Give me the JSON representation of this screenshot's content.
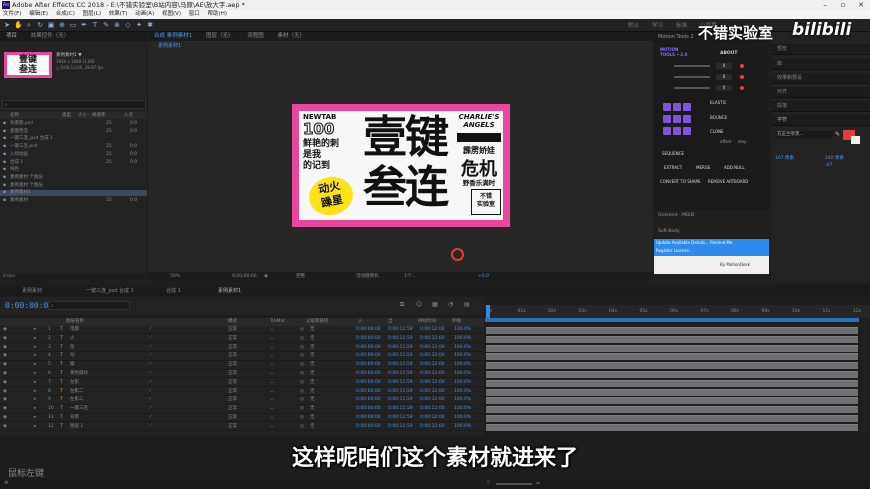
{
  "window": {
    "title": "Adobe After Effects CC 2018 - E:\\不错实验室\\B站内容\\马原\\AE\\放大字.aep *",
    "app_icon": "Ae"
  },
  "menu": [
    "文件(F)",
    "编辑(E)",
    "合成(C)",
    "图层(L)",
    "效果(T)",
    "动画(A)",
    "视图(V)",
    "窗口",
    "帮助(H)"
  ],
  "workspaces": [
    "默认",
    "学习",
    "标准",
    "小屏幕"
  ],
  "project_panel": {
    "tabs": [
      "项目",
      "效果控件（无）"
    ],
    "item_name": "素例素材1 ▼",
    "item_info_1": "1920 x 1080 (1.00)",
    "item_info_2": "△ 0;00;12;00, 29.97 fps",
    "search_placeholder": "",
    "columns": [
      "名称",
      "类型",
      "大小",
      "帧速率",
      "入点"
    ],
    "rows": [
      {
        "name": "背景图.psd",
        "fps": "25",
        "in": "0:0"
      },
      {
        "name": "壹键叁连",
        "fps": "25",
        "in": "0:0"
      },
      {
        "name": "一键三连_psd  合成 1",
        "fps": "",
        "in": ""
      },
      {
        "name": "一键三连.psd",
        "fps": "25",
        "in": "0:0"
      },
      {
        "name": "入场动画",
        "fps": "25",
        "in": "0:0"
      },
      {
        "name": "合成 1",
        "fps": "25",
        "in": "0:0"
      },
      {
        "name": "纯色",
        "fps": "",
        "in": ""
      },
      {
        "name": "素例素材 个图层",
        "fps": "",
        "in": ""
      },
      {
        "name": "素例素材 个图层",
        "fps": "",
        "in": ""
      },
      {
        "name": "素例素材1",
        "fps": "",
        "in": ""
      },
      {
        "name": "素例素材",
        "fps": "25",
        "in": "0:0"
      }
    ],
    "bpc": "8 bpc"
  },
  "composition_panel": {
    "tabs": [
      "合成 素例素材1",
      "图层（无）",
      "流程图",
      "素材（无）"
    ],
    "breadcrumb": "素例素材1",
    "controls": {
      "zoom": "50%",
      "time": "0;00;00;00",
      "resolution": "完整",
      "camera": "活动摄像机",
      "views": "1个...",
      "exposure": "+0.0"
    }
  },
  "artwork": {
    "headline_left_top": "NEWTAB",
    "headline_left_num": "100",
    "left_lines": [
      "鲜艳的刺",
      "是我",
      "的记到"
    ],
    "sticker": [
      "动火",
      "躁星"
    ],
    "main_line1": "壹键",
    "main_line2": "叁连",
    "right_top": "CHARLIE'S",
    "right_top2": "ANGELS",
    "right_mid": "霹雳娇娃",
    "right_big": "危机",
    "right_small": "野香乐满时",
    "right_badge": [
      "不错",
      "实验室"
    ]
  },
  "right_panels": {
    "tabs": [
      "预览",
      "库",
      "效果和预设",
      "对齐",
      "段落",
      "字符"
    ],
    "char_font": "方正兰亭黑...",
    "char_size": "167 像素",
    "char_leading": "240 像素",
    "char_kerning": "-47"
  },
  "motion_tools": {
    "title": "Motion Tools 2",
    "logo": "MOTION TOOLS • 2.0",
    "about": "ABOUT",
    "labels": [
      "ELASTIC",
      "BOUNCE",
      "CLONE",
      "SEQUENCE",
      "EXTRACT",
      "MERGE",
      "ADD NULL",
      "CONVERT TO SHAPE",
      "REMOVE ARTBOARD"
    ],
    "offset_label": "offset",
    "step_label": "step",
    "value_0": "0",
    "overlord": "Overlord - MGID",
    "softbody": "Soft Body",
    "update_1": "Update Available  Details...  Remind Me",
    "update_2": "Register License...",
    "motiondesk": "By MotionDesk"
  },
  "timeline": {
    "tabs": [
      "素例素材",
      "一键三连_psd 合成 1",
      "合成 1",
      "素例素材1"
    ],
    "timecode": "0:00:00:00",
    "columns": [
      "图层名称",
      "模式",
      "TrkMat",
      "父级和链接",
      "入",
      "出",
      "持续时间",
      "伸缩"
    ],
    "layers": [
      {
        "num": "1",
        "name": "电都",
        "mode": "正常",
        "parent": "无"
      },
      {
        "num": "2",
        "name": "火",
        "mode": "正常",
        "parent": "无"
      },
      {
        "num": "3",
        "name": "星",
        "mode": "正常",
        "parent": "无"
      },
      {
        "num": "4",
        "name": "动",
        "mode": "正常",
        "parent": "无"
      },
      {
        "num": "5",
        "name": "躁",
        "mode": "正常",
        "parent": "无"
      },
      {
        "num": "6",
        "name": "黄色圆块",
        "mode": "正常",
        "parent": "无"
      },
      {
        "num": "7",
        "name": "左影",
        "mode": "正常",
        "parent": "无"
      },
      {
        "num": "8",
        "name": "左影二",
        "mode": "正常",
        "parent": "无"
      },
      {
        "num": "9",
        "name": "左影三",
        "mode": "正常",
        "parent": "无"
      },
      {
        "num": "10",
        "name": "一键三连",
        "mode": "正常",
        "parent": "无"
      },
      {
        "num": "11",
        "name": "背景",
        "mode": "正常",
        "parent": "无"
      },
      {
        "num": "12",
        "name": "图层 1",
        "mode": "正常",
        "parent": "无"
      }
    ],
    "in_time": "0:00:00:00",
    "out_time": "0:00:11:59",
    "duration": "0:00:12:00",
    "stretch": "100.0%",
    "ruler": [
      "0s",
      "01s",
      "02s",
      "03s",
      "04s",
      "05s",
      "06s",
      "07s",
      "08s",
      "09s",
      "10s",
      "11s",
      "12s"
    ]
  },
  "overlay": {
    "subtitle": "这样呢咱们这个素材就进来了",
    "watermark_cn": "不错实验室",
    "watermark_bili": "bilibili",
    "mouse_hint": "鼠标左键"
  },
  "colors": {
    "accent_blue": "#2d8ceb",
    "art_pink": "#e8479b",
    "motion_purple": "#7d53e0",
    "track_gray": "#6d6f72"
  }
}
